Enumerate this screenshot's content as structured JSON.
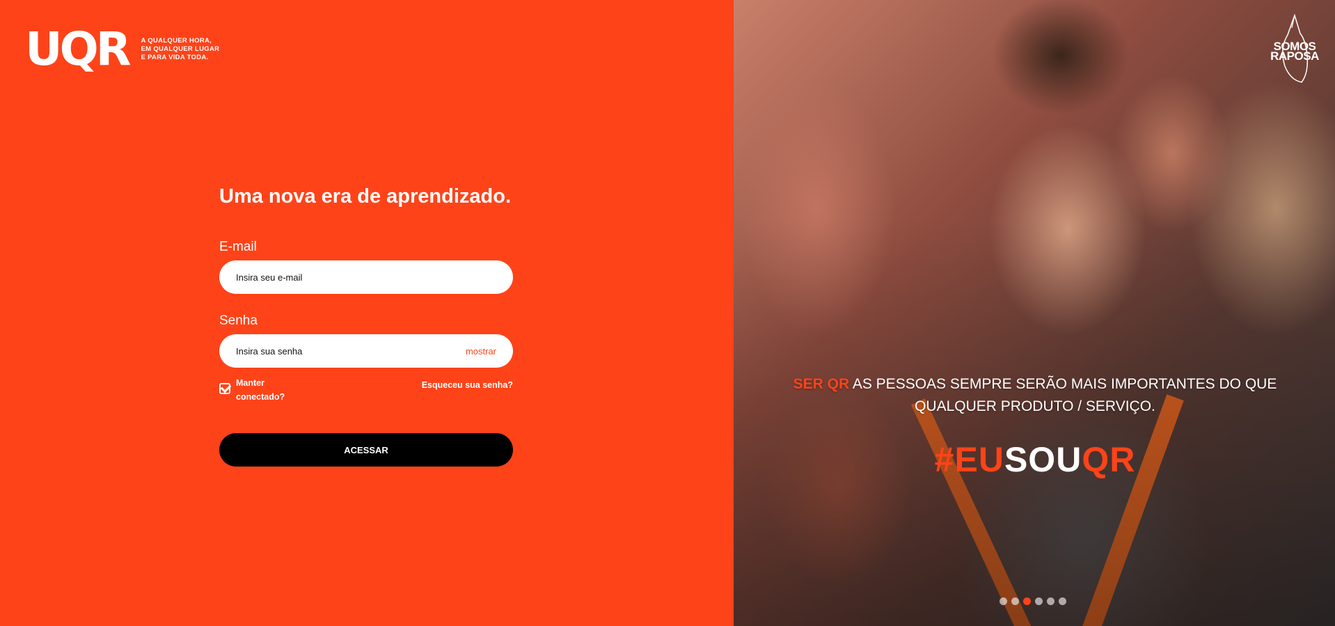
{
  "brand": {
    "logo_text": "UQR",
    "tagline_lines": [
      "A QUALQUER HORA,",
      "EM QUALQUER LUGAR",
      "E PARA VIDA TODA."
    ],
    "accent_color": "#fe4319"
  },
  "login": {
    "headline": "Uma nova era de aprendizado.",
    "email_label": "E-mail",
    "email_placeholder": "Insira seu e-mail",
    "password_label": "Senha",
    "password_placeholder": "Insira sua senha",
    "show_password": "mostrar",
    "keep_connected_line1": "Manter",
    "keep_connected_line2": "conectado?",
    "keep_connected_checked": true,
    "forgot_password": "Esqueceu sua senha?",
    "submit": "ACESSAR"
  },
  "hero": {
    "quote_accent": "SER QR",
    "quote_line1": "AS PESSOAS SEMPRE SERÃO MAIS IMPORTANTES DO QUE",
    "quote_line2": "QUALQUER PRODUTO / SERVIÇO.",
    "hashtag": {
      "hash": "#",
      "eu": "EU",
      "sou": "SOU",
      "qr": "QR"
    },
    "badge_line1": "SOMOS",
    "badge_line2": "RAPOSA",
    "carousel": {
      "count": 6,
      "active_index": 2
    }
  }
}
